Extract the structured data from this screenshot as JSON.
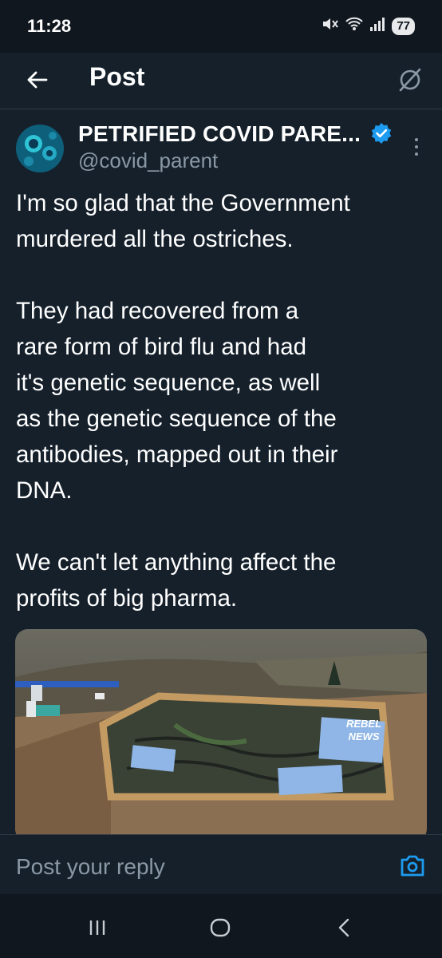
{
  "status_bar": {
    "time": "11:28",
    "battery": "77",
    "icons": [
      "mute-icon",
      "wifi-icon",
      "signal-icon"
    ]
  },
  "header": {
    "back_icon": "back-arrow-icon",
    "title": "Post",
    "grok_icon": "grok-icon"
  },
  "post": {
    "author": {
      "display_name": "PETRIFIED COVID PARE...",
      "handle": "@covid_parent",
      "verified": true
    },
    "paragraphs": [
      "I'm so glad that the Government\nmurdered all the ostriches.",
      "They had recovered from a\nrare form of bird flu and had\nit's genetic sequence, as well\nas the genetic sequence of the\nantibodies, mapped out in their\nDNA.",
      "We can't let anything affect the\nprofits of big pharma."
    ],
    "media": {
      "watermark_line1": "REBEL",
      "watermark_line2": "NEWS"
    }
  },
  "reply": {
    "placeholder": "Post your reply",
    "camera_icon": "camera-icon"
  },
  "colors": {
    "background": "#15202b",
    "accent": "#1d9bf0",
    "muted_text": "#8b98a5"
  }
}
